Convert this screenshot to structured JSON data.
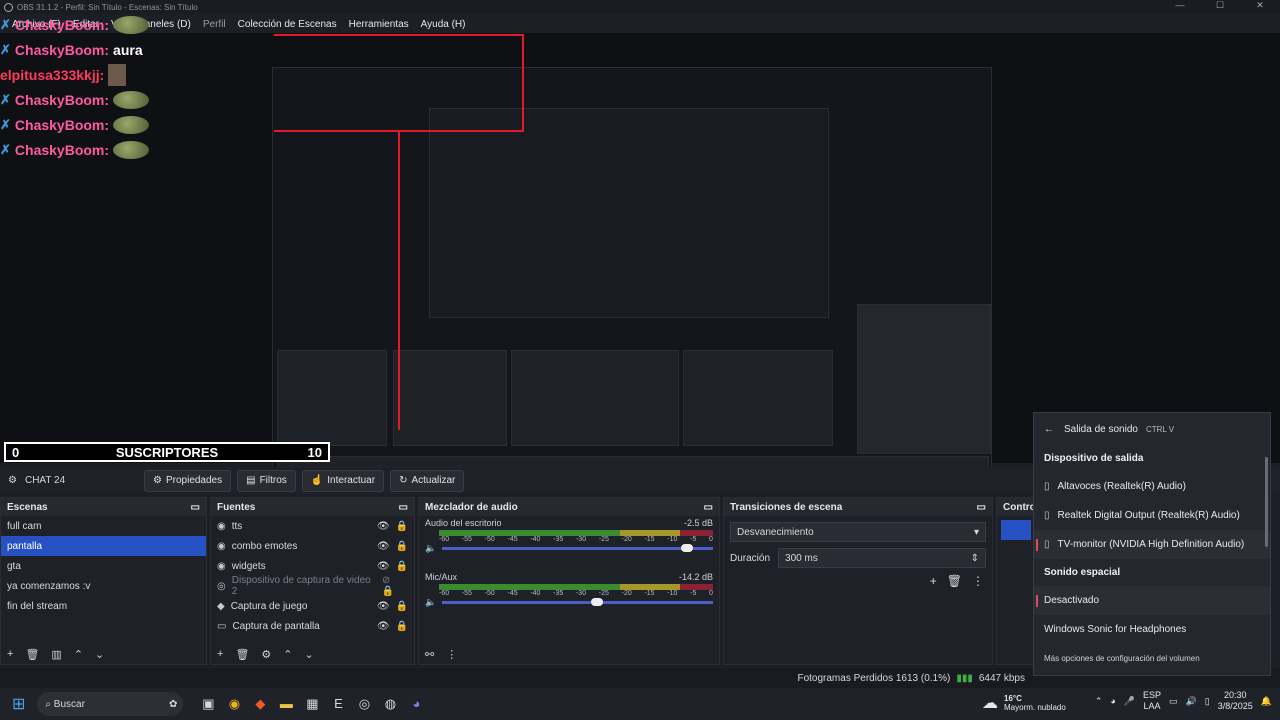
{
  "window": {
    "title": "OBS 31.1.2 - Perfil: Sin Título - Escenas: Sin Título"
  },
  "menu": [
    "Archivo (F)",
    "Editar",
    "Ver",
    "Paneles (D)",
    "Perfil",
    "Colección de Escenas",
    "Herramientas",
    "Ayuda (H)"
  ],
  "chat": [
    {
      "user": "ChaskyBoom:",
      "msg": "aura",
      "type": "a"
    },
    {
      "user": "elpitusa333kkjj:",
      "msg": "",
      "type": "b"
    },
    {
      "user": "ChaskyBoom:",
      "msg": "",
      "type": "a"
    },
    {
      "user": "ChaskyBoom:",
      "msg": "",
      "type": "a"
    },
    {
      "user": "ChaskyBoom:",
      "msg": "",
      "type": "a"
    }
  ],
  "chat_first": {
    "user": "ChaskyBoom:"
  },
  "subs_bar": {
    "left": "0",
    "label": "SUSCRIPTORES",
    "right": "10"
  },
  "toolbar": {
    "scene": "CHAT 24",
    "props": "Propiedades",
    "filters": "Filtros",
    "interact": "Interactuar",
    "refresh": "Actualizar"
  },
  "scenes": {
    "title": "Escenas",
    "items": [
      "full cam",
      "pantalla",
      "gta",
      "ya comenzamos :v",
      "fin del stream"
    ],
    "selected": 1
  },
  "sources": {
    "title": "Fuentes",
    "items": [
      "tts",
      "combo emotes",
      "widgets",
      "Dispositivo de captura de video 2",
      "Captura de juego",
      "Captura de pantalla"
    ]
  },
  "mixer": {
    "title": "Mezclador de audio",
    "ch1": {
      "name": "Audio del escritorio",
      "db": "-2.5 dB"
    },
    "ch2": {
      "name": "Mic/Aux",
      "db": "-14.2 dB"
    },
    "ticks": [
      "-60",
      "-55",
      "-50",
      "-45",
      "-40",
      "-35",
      "-30",
      "-25",
      "-20",
      "-15",
      "-10",
      "-5",
      "0"
    ]
  },
  "transitions": {
    "title": "Transiciones de escena",
    "type": "Desvanecimiento",
    "dur_label": "Duración",
    "dur": "300 ms"
  },
  "controls": {
    "title": "Control"
  },
  "status": {
    "frames": "Fotogramas Perdidos 1613 (0.1%)",
    "kbps": "6447 kbps"
  },
  "flyout": {
    "title": "Salida de sonido",
    "shortcut": "CTRL  V",
    "sec1": "Dispositivo de salida",
    "dev1": "Altavoces (Realtek(R) Audio)",
    "dev2": "Realtek Digital Output (Realtek(R) Audio)",
    "dev3": "TV-monitor (NVIDIA High Definition Audio)",
    "sec2": "Sonido espacial",
    "sp1": "Desactivado",
    "sp2": "Windows Sonic for Headphones",
    "more": "Más opciones de configuración del volumen"
  },
  "taskbar": {
    "search": "Buscar",
    "temp": "16°C",
    "weather": "Mayorm. nublado",
    "lang1": "ESP",
    "lang2": "LAA",
    "time": "20:30",
    "date": "3/8/2025"
  },
  "colors": {
    "accent": "#2750c2",
    "chat_user": "#ff5aa0",
    "red": "#e31a2a"
  }
}
